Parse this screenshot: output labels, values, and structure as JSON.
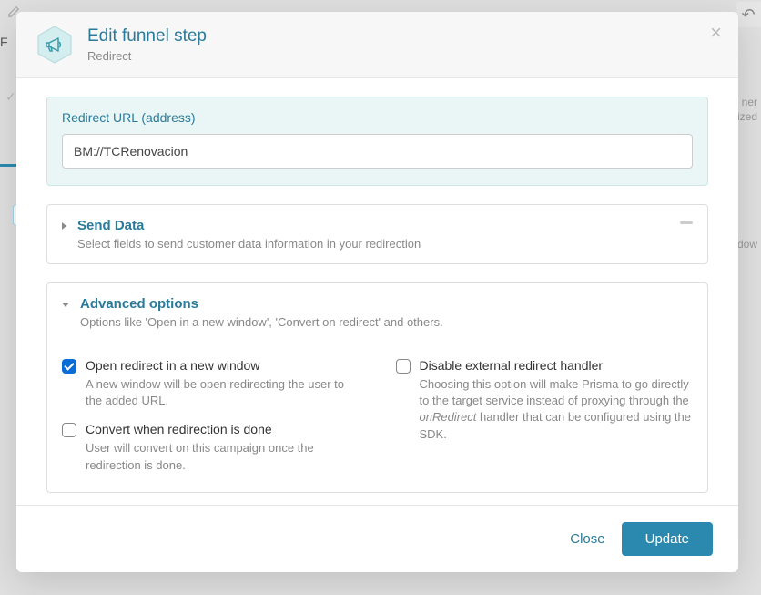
{
  "modal": {
    "title": "Edit funnel step",
    "subtitle": "Redirect",
    "close_symbol": "×"
  },
  "redirect": {
    "label": "Redirect URL (address)",
    "value": "BM://TCRenovacion"
  },
  "send_data": {
    "title": "Send Data",
    "desc": "Select fields to send customer data information in your redirection"
  },
  "advanced": {
    "title": "Advanced options",
    "desc": "Options like 'Open in a new window', 'Convert on redirect' and others.",
    "options": {
      "open_new_window": {
        "label": "Open redirect in a new window",
        "help": "A new window will be open redirecting the user to the added URL.",
        "checked": true
      },
      "convert_on_done": {
        "label": "Convert when redirection is done",
        "help": "User will convert on this campaign once the redirection is done.",
        "checked": false
      },
      "disable_handler": {
        "label": "Disable external redirect handler",
        "help_pre": "Choosing this option will make Prisma to go directly to the target service instead of proxying through the ",
        "help_em": "onRedirect",
        "help_post": " handler that can be configured using the SDK.",
        "checked": false
      }
    }
  },
  "footer": {
    "close": "Close",
    "update": "Update"
  },
  "bg": {
    "right1": "ner",
    "right2": "lized",
    "right3": "dow",
    "letter": "F"
  }
}
